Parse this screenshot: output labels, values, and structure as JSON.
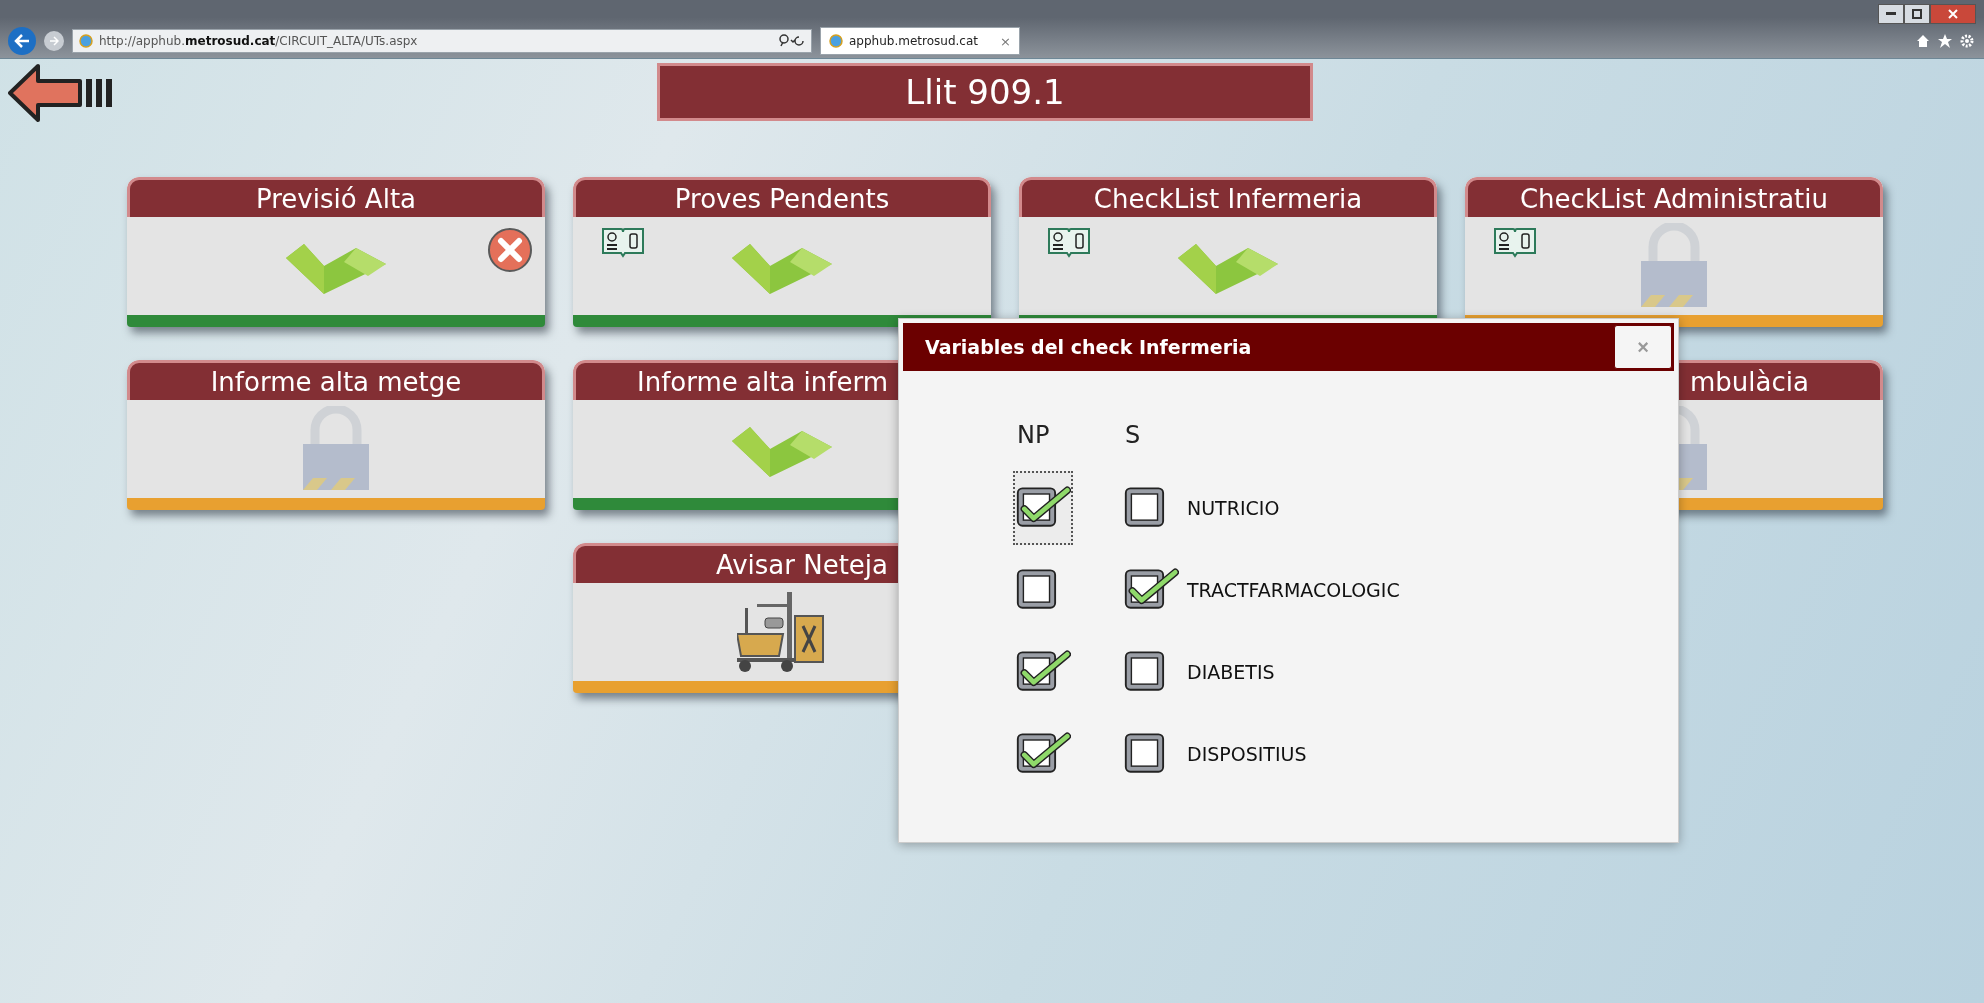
{
  "browser": {
    "url": "http://apphub.**metrosud.cat**/CIRCUIT_ALTA/UTs.aspx",
    "tab": {
      "title": "apphub.metrosud.cat",
      "close": "×"
    }
  },
  "page": {
    "title": "Llit 909.1"
  },
  "card_rows": [
    [
      {
        "title": "Previsió Alta",
        "kind": "check",
        "book": false,
        "cancel": true,
        "done": true
      },
      {
        "title": "Proves Pendents",
        "kind": "check",
        "book": true,
        "cancel": false,
        "done": true
      },
      {
        "title": "CheckList Infermeria",
        "kind": "check",
        "book": true,
        "cancel": false,
        "done": true
      },
      {
        "title": "CheckList Administratiu",
        "kind": "lock",
        "book": true,
        "cancel": false,
        "done": false
      }
    ],
    [
      {
        "title": "Informe alta metge",
        "kind": "lock",
        "book": false,
        "cancel": false,
        "done": false
      },
      {
        "title": "Informe alta inferm",
        "kind": "check",
        "book": false,
        "cancel": false,
        "done": true,
        "cut_right": true
      },
      {
        "title": "mbulàcia",
        "kind": "lock",
        "book": false,
        "cancel": false,
        "done": false,
        "cut_left": true
      }
    ],
    [
      {
        "title": "Avisar Neteja",
        "kind": "cart",
        "book": false,
        "cancel": false,
        "done": false,
        "cut_right": true
      }
    ]
  ],
  "dialog": {
    "title": "Variables del check Infermeria",
    "close": "×",
    "columns": [
      "NP",
      "S"
    ],
    "rows": [
      {
        "label": "NUTRICIO",
        "np": true,
        "s": false,
        "focused": true
      },
      {
        "label": "TRACTFARMACOLOGIC",
        "np": false,
        "s": true,
        "focused": false
      },
      {
        "label": "DIABETIS",
        "np": true,
        "s": false,
        "focused": false
      },
      {
        "label": "DISPOSITIUS",
        "np": true,
        "s": false,
        "focused": false
      }
    ]
  }
}
